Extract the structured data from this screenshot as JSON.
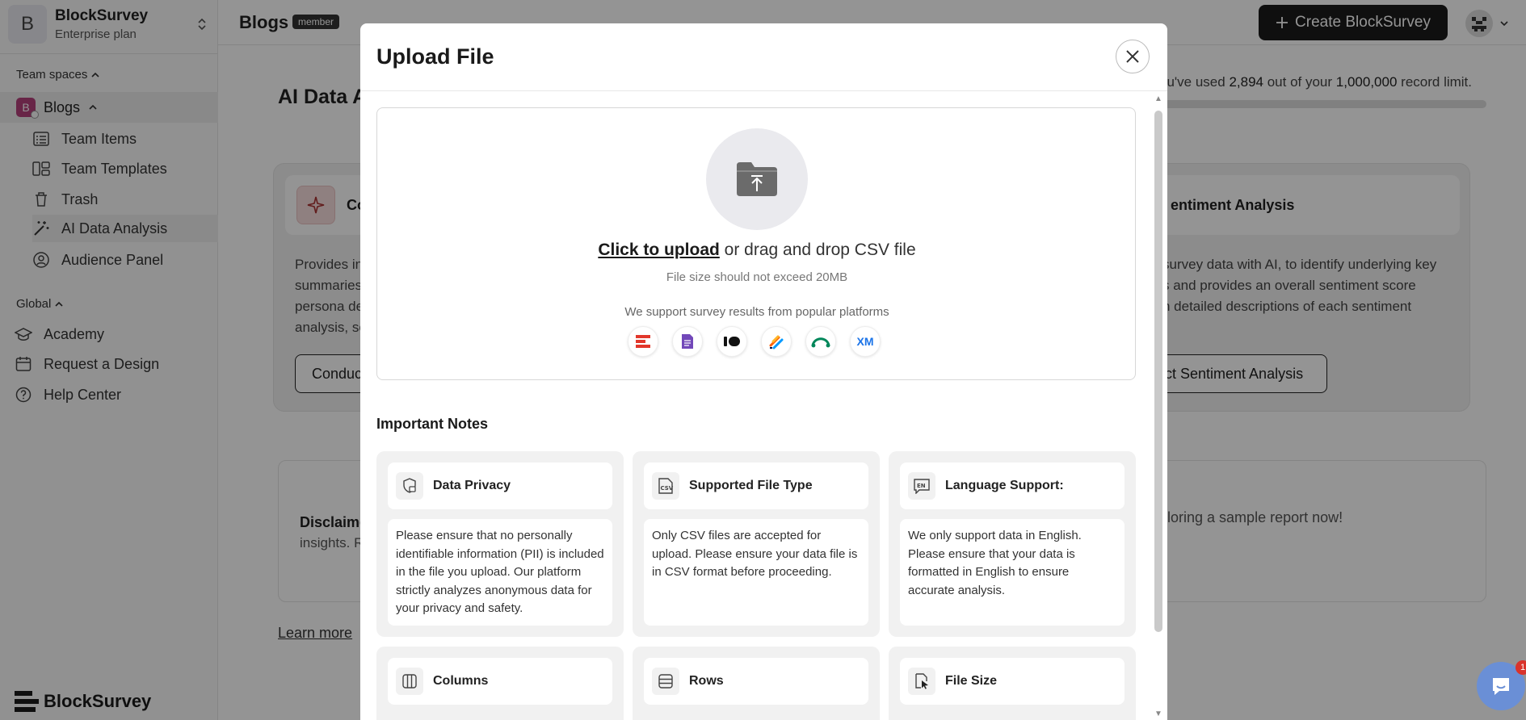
{
  "workspace": {
    "initial": "B",
    "name": "BlockSurvey",
    "plan": "Enterprise plan"
  },
  "sidebar": {
    "team_spaces_label": "Team spaces",
    "team": {
      "initial": "B",
      "name": "Blogs"
    },
    "team_items": [
      {
        "label": "Team Items",
        "icon": "list-icon"
      },
      {
        "label": "Team Templates",
        "icon": "templates-icon"
      },
      {
        "label": "Trash",
        "icon": "trash-icon"
      },
      {
        "label": "AI Data Analysis",
        "icon": "magic-wand-icon"
      },
      {
        "label": "Audience Panel",
        "icon": "audience-icon"
      }
    ],
    "global_label": "Global",
    "global_items": [
      {
        "label": "Academy",
        "icon": "academy-icon"
      },
      {
        "label": "Request a Design",
        "icon": "calendar-icon"
      },
      {
        "label": "Help Center",
        "icon": "help-icon"
      }
    ],
    "brand": "BlockSurvey"
  },
  "header": {
    "title": "Blogs",
    "badge": "member",
    "create_button": "Create BlockSurvey"
  },
  "main": {
    "heading": "AI Data A",
    "usage": {
      "prefix": "ou've used",
      "used": "2,894",
      "middle": "out of your",
      "limit": "1,000,000",
      "suffix": "record limit."
    },
    "card_left": {
      "title": "Co",
      "lines": [
        "Provides in",
        "summaries",
        "persona de",
        "analysis, se"
      ],
      "button": "Conduc"
    },
    "card_right": {
      "title": "entiment Analysis",
      "lines": [
        "survey data with AI, to identify underlying key",
        "s and provides an overall sentiment score",
        "h detailed descriptions of each sentiment"
      ],
      "button": "ct Sentiment Analysis"
    },
    "disclaimer_title": "Disclaime",
    "disclaimer_sub": "insights. R",
    "disclaimer_right": "ploring a sample report now!",
    "learn_more": "Learn more"
  },
  "modal": {
    "title": "Upload File",
    "upload_link": "Click to upload",
    "upload_rest": " or drag and drop CSV file",
    "size_note": "File size should not exceed 20MB",
    "support_note": "We support survey results from popular platforms",
    "platforms": [
      "surveysparrow-icon",
      "google-forms-icon",
      "typeform-icon",
      "jotform-icon",
      "surveymonkey-icon",
      "qualtrics-icon"
    ],
    "notes_title": "Important Notes",
    "notes": [
      {
        "title": "Data Privacy",
        "icon": "privacy-icon",
        "body": "Please ensure that no personally identifiable information (PII) is included in the file you upload. Our platform strictly analyzes anonymous data for your privacy and safety."
      },
      {
        "title": "Supported File Type",
        "icon": "csv-icon",
        "body": "Only CSV files are accepted for upload. Please ensure your data file is in CSV format before proceeding."
      },
      {
        "title": "Language Support:",
        "icon": "language-icon",
        "body": "We only support data in English. Please ensure that your data is formatted in English to ensure accurate analysis."
      },
      {
        "title": "Columns",
        "icon": "columns-icon",
        "body": ""
      },
      {
        "title": "Rows",
        "icon": "rows-icon",
        "body": ""
      },
      {
        "title": "File Size",
        "icon": "file-size-icon",
        "body": ""
      }
    ]
  },
  "chat": {
    "badge": "1"
  },
  "colors": {
    "primary": "#1b1b1b",
    "team_badge": "#b3407a",
    "chat": "#6a8fd6",
    "alert": "#d9332b"
  }
}
